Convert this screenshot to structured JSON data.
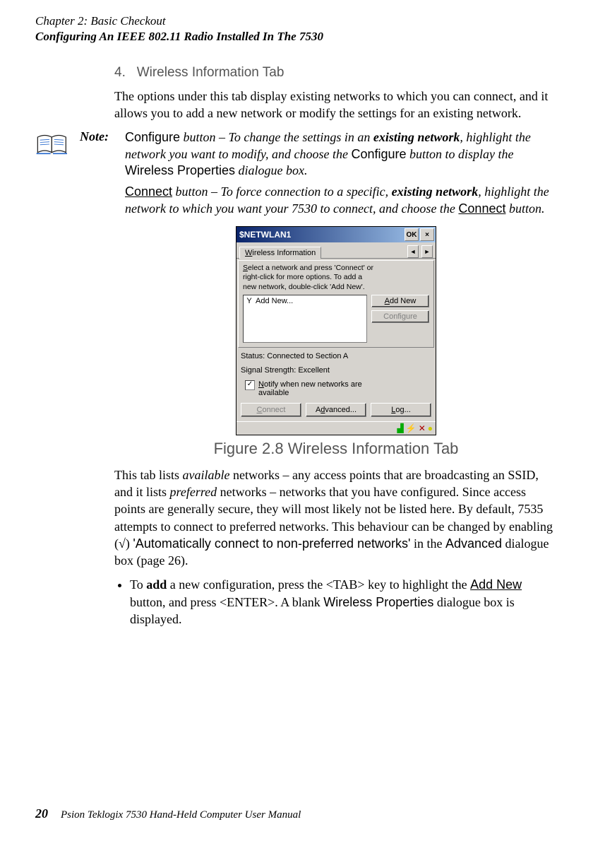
{
  "header": {
    "chapter": "Chapter 2: Basic Checkout",
    "section": "Configuring An IEEE 802.11 Radio Installed In The 7530"
  },
  "step": {
    "number": "4.",
    "title": "Wireless Information Tab"
  },
  "intro": "The options under this tab display existing networks to which you can connect, and it allows you to add a new network or modify the settings for an existing network.",
  "note": {
    "label": "Note:",
    "p1_a": "Configure",
    "p1_b": " button – To change the settings in an ",
    "p1_c": "existing network",
    "p1_d": ", highlight the network you want to modify, and choose the ",
    "p1_e": "Configure",
    "p1_f": " button to display the ",
    "p1_g": "Wireless Properties",
    "p1_h": " dialogue box.",
    "p2_a": "Connect",
    "p2_b": " button – To force connection to a specific, ",
    "p2_c": "existing network",
    "p2_d": ", highlight the network to which you want your 7530 to connect, and choose the ",
    "p2_e": "Connect",
    "p2_f": " button."
  },
  "screenshot": {
    "title": "$NETWLAN1",
    "ok": "OK",
    "close": "×",
    "tab": "Wireless Information",
    "arrow_left": "◄",
    "arrow_right": "►",
    "instr_l1": "Select a network and press 'Connect' or",
    "instr_l2": "right-click for more options.  To add a",
    "instr_l3": "new network, double-click 'Add New'.",
    "list_item": "Add New...",
    "btn_addnew": "Add New",
    "btn_configure": "Configure",
    "status": "Status:   Connected to Section A",
    "signal": "Signal Strength:  Excellent",
    "notify_l1": "Notify when new networks are",
    "notify_l2": "available",
    "check": "✓",
    "btn_connect": "Connect",
    "btn_advanced": "Advanced...",
    "btn_log": "Log..."
  },
  "figure_caption": "Figure 2.8 Wireless Information Tab",
  "para2": {
    "a": "This tab lists ",
    "b": "available",
    "c": " networks – any access points that are broadcasting an SSID, and it lists ",
    "d": "preferred",
    "e": " networks – networks that you have configured. Since access points are generally secure, they will most likely not be listed here. By default, 7535 attempts to connect to preferred networks. This behaviour can be changed by enabling (√) ",
    "f": "'Automatically connect to non-preferred networks'",
    "g": " in the ",
    "h": "Advanced",
    "i": " dialogue box (page 26)."
  },
  "bullet": {
    "a": "To ",
    "b": "add",
    "c": " a new configuration, press the <TAB> key to highlight the ",
    "d": "Add New",
    "e": " button, and press <ENTER>. A blank ",
    "f": "Wireless Properties",
    "g": " dialogue box is displayed."
  },
  "footer": {
    "page": "20",
    "text": "Psion Teklogix 7530 Hand-Held Computer User Manual"
  }
}
